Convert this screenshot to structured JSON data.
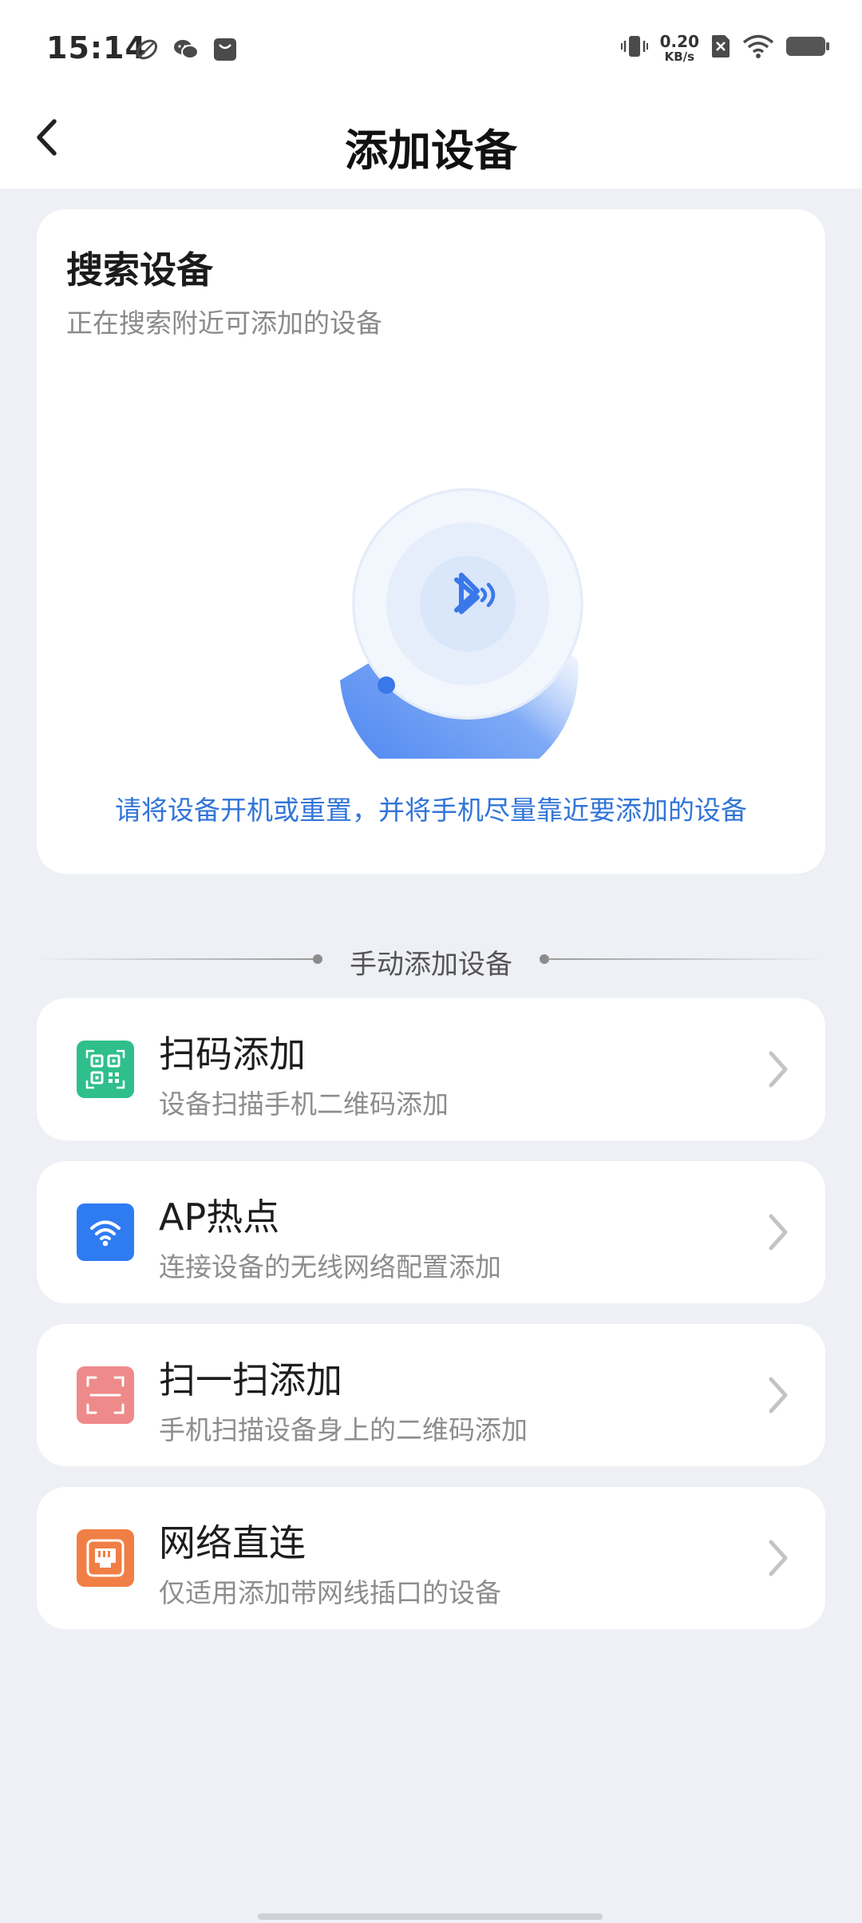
{
  "status_bar": {
    "time": "15:14",
    "net_speed_value": "0.20",
    "net_speed_unit": "KB/s",
    "icons": [
      "leaf-app-icon",
      "wechat-icon",
      "message-icon",
      "vibrate-icon",
      "no-sim-icon",
      "wifi-icon",
      "battery-icon"
    ]
  },
  "header": {
    "title": "添加设备",
    "back_icon": "chevron-left-icon"
  },
  "search_card": {
    "title": "搜索设备",
    "subtitle": "正在搜索附近可添加的设备",
    "radar_icon": "bluetooth-icon",
    "hint": "请将设备开机或重置，并将手机尽量靠近要添加的设备"
  },
  "divider": {
    "label": "手动添加设备"
  },
  "options": [
    {
      "title": "扫码添加",
      "subtitle": "设备扫描手机二维码添加",
      "icon": "qr-code-icon",
      "color": "#2fbf8c"
    },
    {
      "title": "AP热点",
      "subtitle": "连接设备的无线网络配置添加",
      "icon": "wifi-icon",
      "color": "#2f7bf2"
    },
    {
      "title": "扫一扫添加",
      "subtitle": "手机扫描设备身上的二维码添加",
      "icon": "scan-icon",
      "color": "#ef8a8a"
    },
    {
      "title": "网络直连",
      "subtitle": "仅适用添加带网线插口的设备",
      "icon": "ethernet-port-icon",
      "color": "#f07f45"
    }
  ],
  "colors": {
    "background": "#eef0f5",
    "accent": "#3275d8"
  }
}
